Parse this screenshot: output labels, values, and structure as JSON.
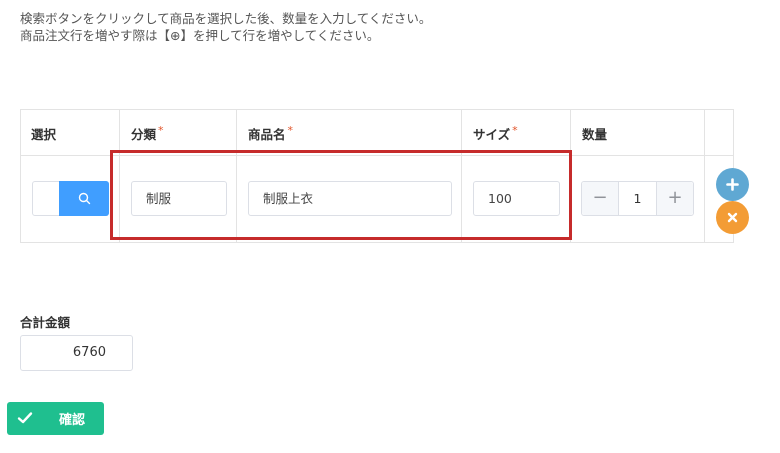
{
  "instructions": {
    "line1": "検索ボタンをクリックして商品を選択した後、数量を入力してください。",
    "line2": "商品注文行を増やす際は【⊕】を押して行を増やしてください。"
  },
  "table": {
    "headers": {
      "select": "選択",
      "category": "分類",
      "product_name": "商品名",
      "size": "サイズ",
      "quantity": "数量"
    },
    "required_mark": "*",
    "row": {
      "category": "制服",
      "product_name": "制服上衣",
      "size": "100",
      "quantity": "1"
    },
    "stepper": {
      "minus": "−",
      "plus": "+"
    }
  },
  "total": {
    "label": "合計金額",
    "value": "6760"
  },
  "confirm": {
    "label": "確認"
  },
  "icons": {
    "search": "search-icon",
    "add": "plus-circle-icon",
    "remove": "close-circle-icon",
    "check": "check-icon"
  },
  "colors": {
    "primary": "#409eff",
    "add": "#5fa8d3",
    "remove": "#f39c35",
    "confirm": "#1fbf8f",
    "highlight": "#c62b2b",
    "required": "#e2542a"
  }
}
